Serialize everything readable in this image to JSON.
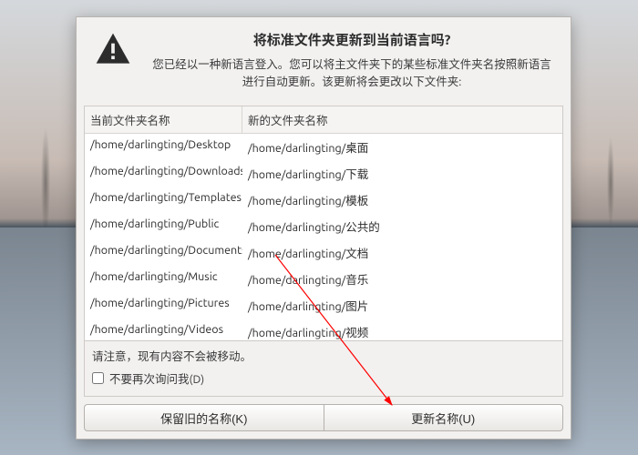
{
  "dialog": {
    "title": "将标准文件夹更新到当前语言吗?",
    "description": "您已经以一种新语言登入。您可以将主文件夹下的某些标准文件夹名按照新语言进行自动更新。该更新将会更改以下文件夹:",
    "columns": {
      "old": "当前文件夹名称",
      "new": "新的文件夹名称"
    },
    "rows": [
      {
        "old": "/home/darlingting/Desktop",
        "new": "/home/darlingting/桌面"
      },
      {
        "old": "/home/darlingting/Downloads",
        "new": "/home/darlingting/下载"
      },
      {
        "old": "/home/darlingting/Templates",
        "new": "/home/darlingting/模板"
      },
      {
        "old": "/home/darlingting/Public",
        "new": "/home/darlingting/公共的"
      },
      {
        "old": "/home/darlingting/Documents",
        "new": "/home/darlingting/文档"
      },
      {
        "old": "/home/darlingting/Music",
        "new": "/home/darlingting/音乐"
      },
      {
        "old": "/home/darlingting/Pictures",
        "new": "/home/darlingting/图片"
      },
      {
        "old": "/home/darlingting/Videos",
        "new": "/home/darlingting/视频"
      }
    ],
    "note": "请注意，现有内容不会被移动。",
    "checkbox_label": "不要再次询问我(D)",
    "checkbox_checked": false,
    "buttons": {
      "keep": "保留旧的名称(K)",
      "update": "更新名称(U)"
    }
  }
}
